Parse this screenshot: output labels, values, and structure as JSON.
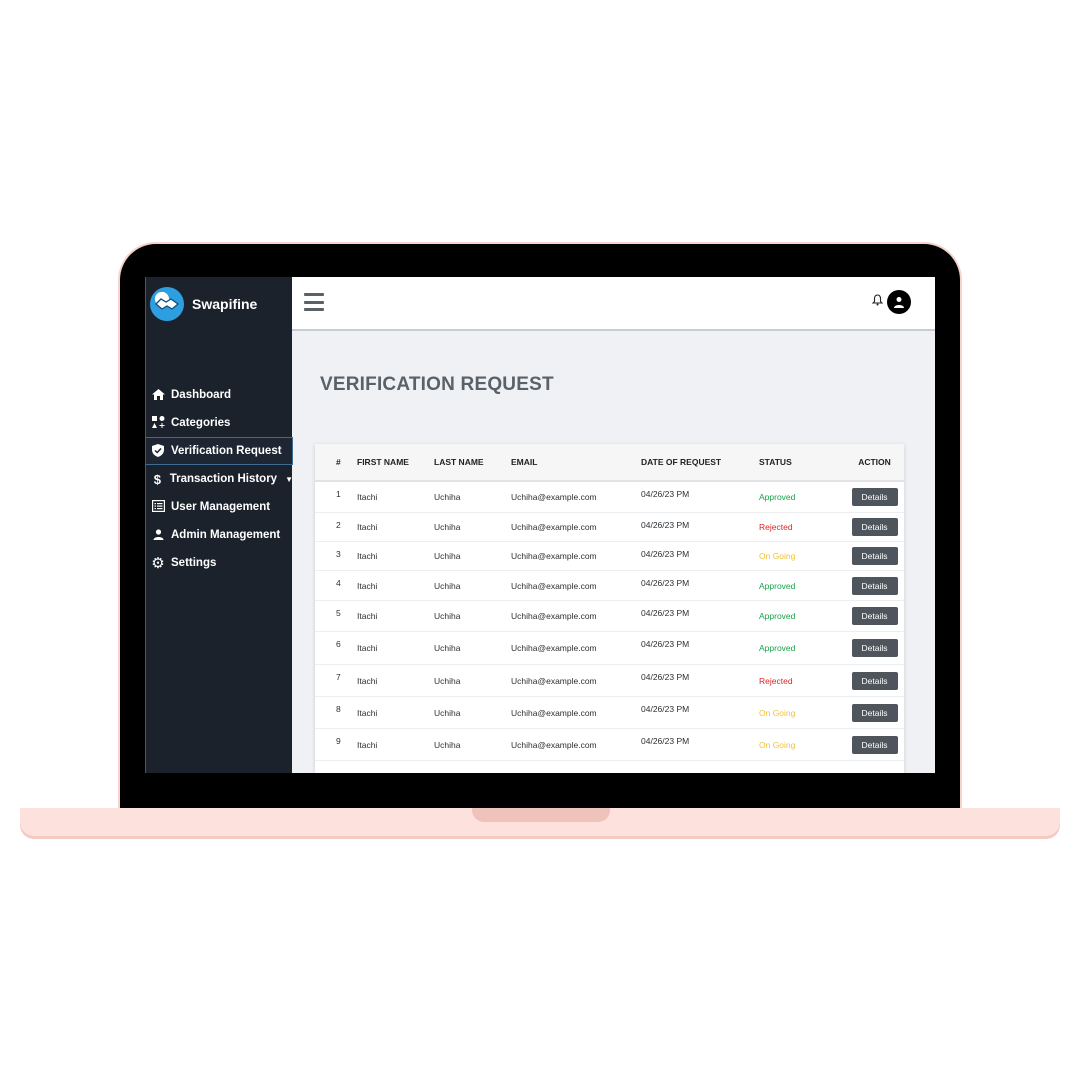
{
  "app": {
    "name": "Swapifine"
  },
  "sidebar": {
    "items": [
      {
        "label": "Dashboard",
        "icon": "home-icon"
      },
      {
        "label": "Categories",
        "icon": "categories-icon"
      },
      {
        "label": "Verification Request",
        "icon": "shield-check-icon",
        "active": true
      },
      {
        "label": "Transaction History",
        "icon": "dollar-icon",
        "has_dropdown": true
      },
      {
        "label": "User Management",
        "icon": "list-icon"
      },
      {
        "label": "Admin Management",
        "icon": "user-icon"
      },
      {
        "label": "Settings",
        "icon": "gear-icon"
      }
    ]
  },
  "topbar": {
    "menu_icon": "hamburger-icon",
    "notification_icon": "bell-icon",
    "avatar_icon": "avatar-icon"
  },
  "page": {
    "title": "VERIFICATION REQUEST"
  },
  "table": {
    "columns": [
      "#",
      "FIRST NAME",
      "LAST NAME",
      "EMAIL",
      "DATE OF REQUEST",
      "STATUS",
      "ACTION"
    ],
    "rows": [
      {
        "num": "1",
        "first": "Itachi",
        "last": "Uchiha",
        "email": "Uchiha@example.com",
        "date": "04/26/23 PM",
        "status": "Approved",
        "action": "Details"
      },
      {
        "num": "2",
        "first": "Itachi",
        "last": "Uchiha",
        "email": "Uchiha@example.com",
        "date": "04/26/23 PM",
        "status": "Rejected",
        "action": "Details"
      },
      {
        "num": "3",
        "first": "Itachi",
        "last": "Uchiha",
        "email": "Uchiha@example.com",
        "date": "04/26/23 PM",
        "status": "On Going",
        "action": "Details"
      },
      {
        "num": "4",
        "first": "Itachi",
        "last": "Uchiha",
        "email": "Uchiha@example.com",
        "date": "04/26/23 PM",
        "status": "Approved",
        "action": "Details"
      },
      {
        "num": "5",
        "first": "Itachi",
        "last": "Uchiha",
        "email": "Uchiha@example.com",
        "date": "04/26/23 PM",
        "status": "Approved",
        "action": "Details"
      },
      {
        "num": "6",
        "first": "Itachi",
        "last": "Uchiha",
        "email": "Uchiha@example.com",
        "date": "04/26/23 PM",
        "status": "Approved",
        "action": "Details"
      },
      {
        "num": "7",
        "first": "Itachi",
        "last": "Uchiha",
        "email": "Uchiha@example.com",
        "date": "04/26/23 PM",
        "status": "Rejected",
        "action": "Details"
      },
      {
        "num": "8",
        "first": "Itachi",
        "last": "Uchiha",
        "email": "Uchiha@example.com",
        "date": "04/26/23 PM",
        "status": "On Going",
        "action": "Details"
      },
      {
        "num": "9",
        "first": "Itachi",
        "last": "Uchiha",
        "email": "Uchiha@example.com",
        "date": "04/26/23 PM",
        "status": "On Going",
        "action": "Details"
      }
    ]
  },
  "colors": {
    "sidebar_bg": "#1b222c",
    "approved": "#16a34a",
    "rejected": "#dc2626",
    "ongoing": "#f2c335",
    "button_bg": "#4e555d"
  }
}
